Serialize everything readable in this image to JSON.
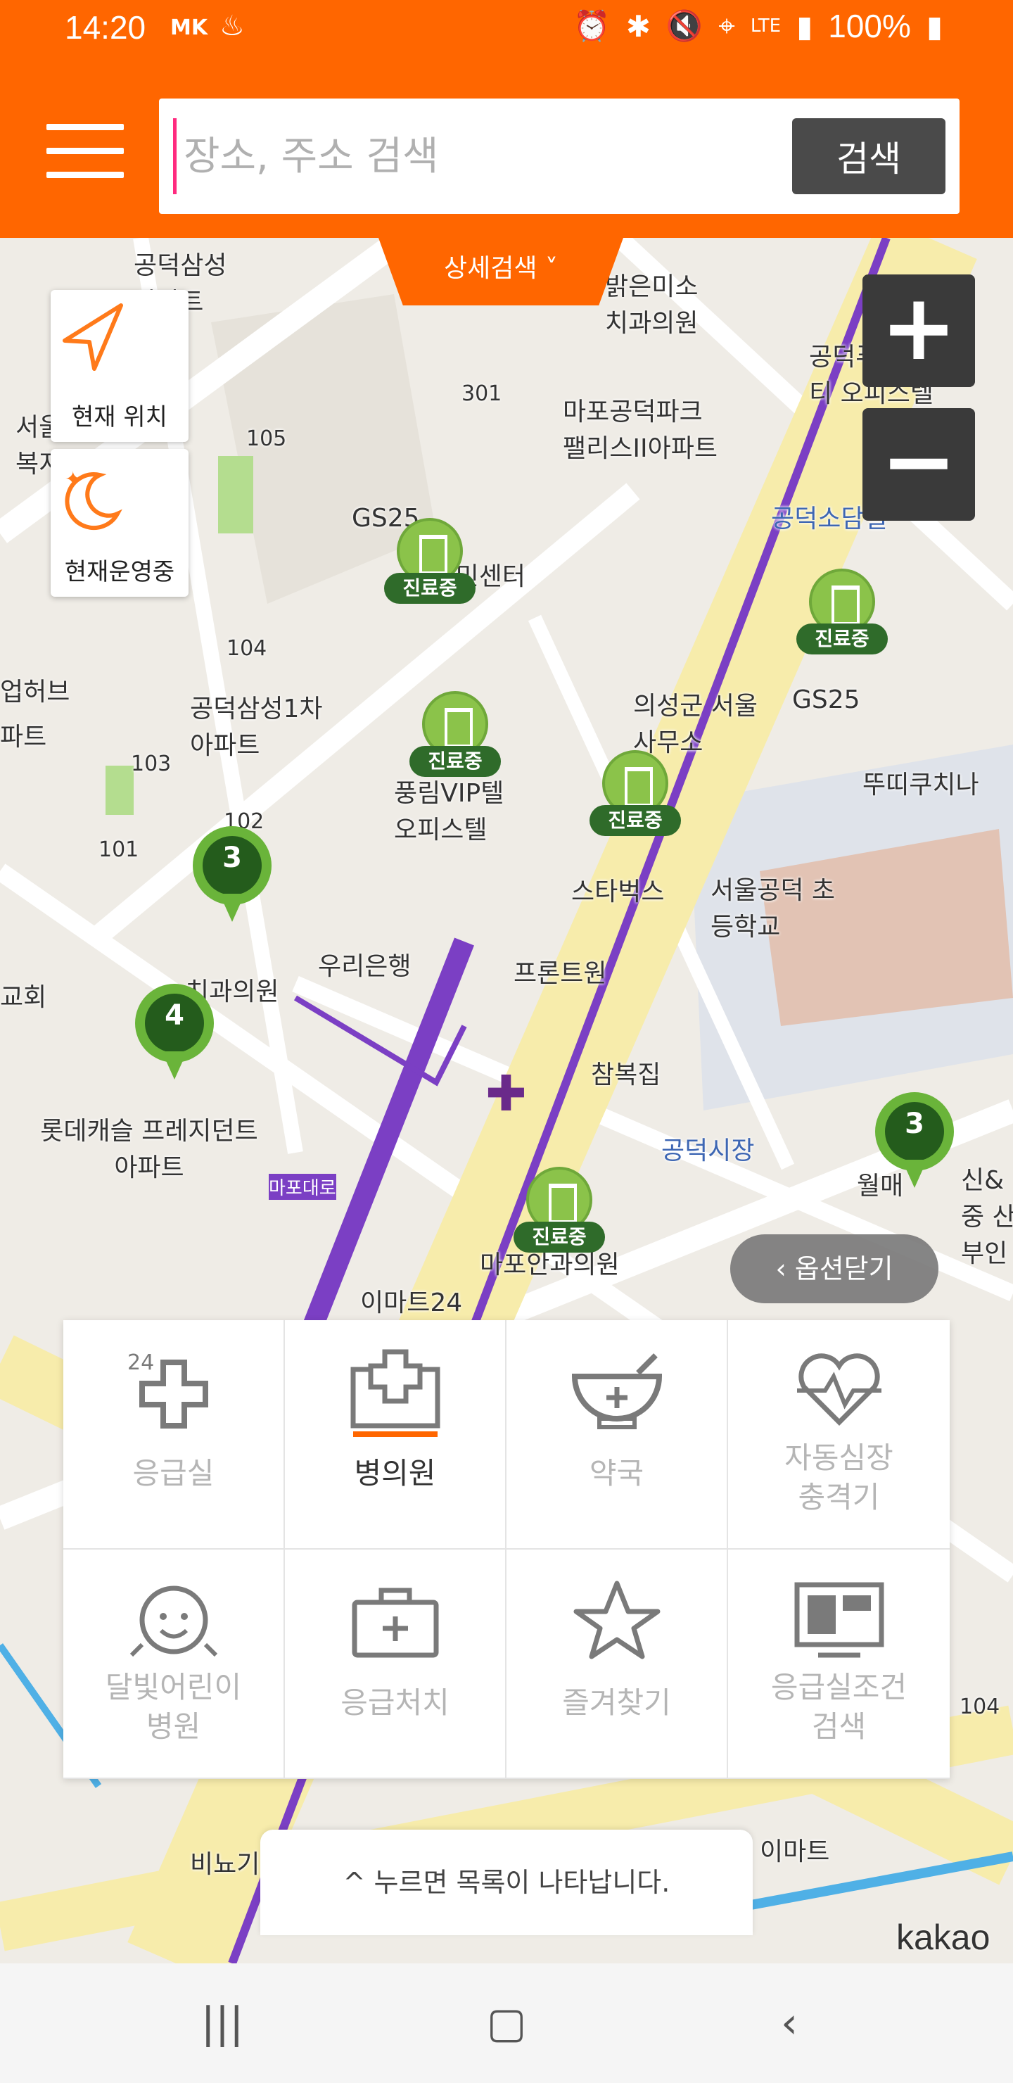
{
  "status_bar": {
    "time": "14:20",
    "carrier": "MK",
    "battery": "100%",
    "network": "LTE"
  },
  "header": {
    "search_placeholder": "장소, 주소 검색",
    "search_button": "검색",
    "detail_search": "상세검색 ˅"
  },
  "map": {
    "controls": {
      "my_location": "현재 위치",
      "open_now": "현재운영중",
      "zoom_in": "+",
      "zoom_out": "−"
    },
    "labels": [
      "공덕삼성 아파트",
      "밝은미소 치과의원",
      "301",
      "105",
      "마포공덕파크 팰리스II아파트",
      "공덕푸르지오시티 오피스텔",
      "공덕소담길",
      "GS25",
      "GS25",
      "동 주민센터",
      "104",
      "공덕삼성1차 아파트",
      "의성군 서울사무소",
      "뚜띠쿠치나",
      "103",
      "풍림VIP텔 오피스텔",
      "102",
      "101",
      "서울공덕 초등학교",
      "스타벅스",
      "우리은행",
      "프론트원",
      "참복집",
      "롯데캐슬 프레지던트아파트",
      "공덕시장",
      "월매",
      "신&중 산부인",
      "마포안과의원",
      "이마트24",
      "서울시조인 종합복지관협회",
      "업허브",
      "파트",
      "교회",
      "치과의원",
      "비뇨기",
      "이마트",
      "104",
      "마포대로"
    ],
    "hospital_tag": "진료중",
    "clusters": [
      "3",
      "4",
      "3"
    ],
    "options_close": "옵션닫기",
    "list_hint": "누르면 목록이 나타납니다.",
    "kakao": "kakao"
  },
  "categories": [
    {
      "label": "응급실",
      "icon": "emergency-24-icon",
      "active": false
    },
    {
      "label": "병의원",
      "icon": "hospital-icon",
      "active": true
    },
    {
      "label": "약국",
      "icon": "pharmacy-icon",
      "active": false
    },
    {
      "label": "자동심장\n충격기",
      "icon": "aed-icon",
      "active": false
    },
    {
      "label": "달빛어린이\n병원",
      "icon": "child-hospital-icon",
      "active": false
    },
    {
      "label": "응급처치",
      "icon": "first-aid-icon",
      "active": false
    },
    {
      "label": "즐겨찾기",
      "icon": "star-icon",
      "active": false
    },
    {
      "label": "응급실조건\n검색",
      "icon": "monitor-icon",
      "active": false
    }
  ],
  "colors": {
    "brand": "#ff6600",
    "active_accent": "#ff6600",
    "pin_green": "#8bc34a",
    "subway_line": "#7b3fc4"
  }
}
